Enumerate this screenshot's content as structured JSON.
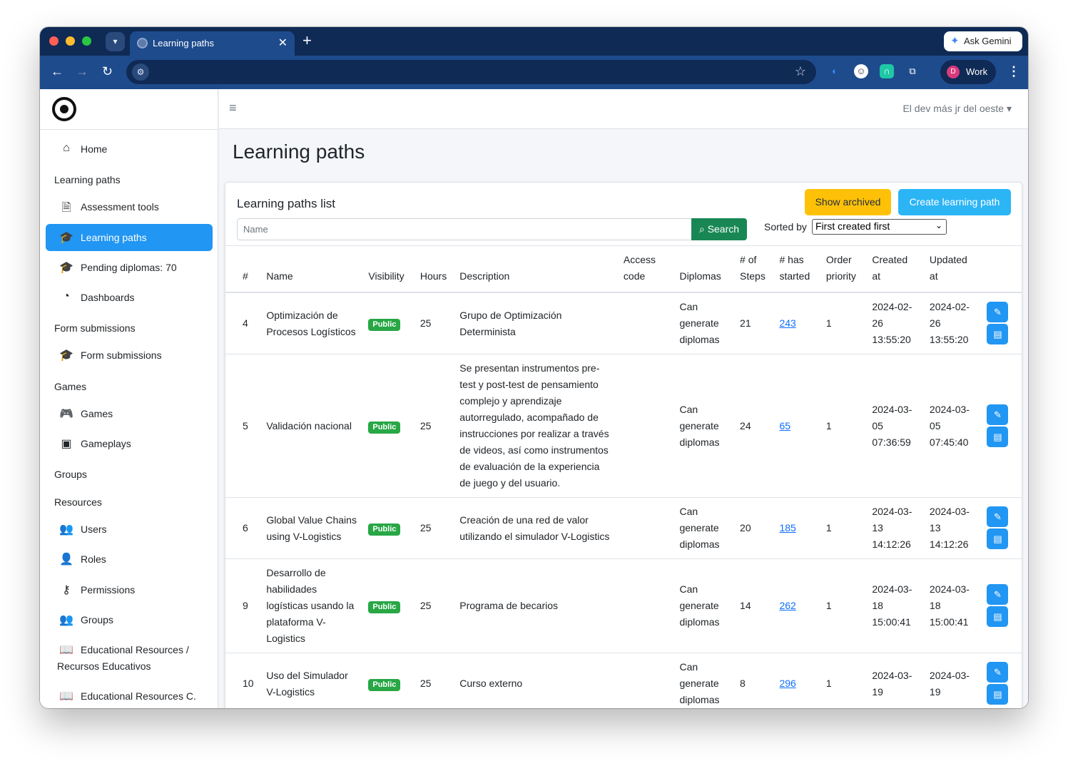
{
  "browser": {
    "tab_title": "Learning paths",
    "tab_close": "✕",
    "new_tab": "+",
    "ask_gemini": "Ask Gemini",
    "profile_initial": "D",
    "profile_name": "Work"
  },
  "sidebar": {
    "items": [
      {
        "type": "item",
        "icon": "home-icon",
        "label": "Home"
      },
      {
        "type": "header",
        "label": "Learning paths"
      },
      {
        "type": "item",
        "icon": "file-icon",
        "label": "Assessment tools"
      },
      {
        "type": "item",
        "icon": "graduation-cap-icon",
        "label": "Learning paths",
        "active": true
      },
      {
        "type": "item",
        "icon": "graduation-cap-icon",
        "label": "Pending diplomas: 70"
      },
      {
        "type": "item",
        "icon": "dashboard-icon",
        "label": "Dashboards"
      },
      {
        "type": "header",
        "label": "Form submissions"
      },
      {
        "type": "item",
        "icon": "graduation-cap-icon",
        "label": "Form submissions"
      },
      {
        "type": "header",
        "label": "Games"
      },
      {
        "type": "item",
        "icon": "gamepad-icon",
        "label": "Games"
      },
      {
        "type": "item",
        "icon": "save-icon",
        "label": "Gameplays"
      },
      {
        "type": "header",
        "label": "Groups"
      },
      {
        "type": "header",
        "label": "Resources"
      },
      {
        "type": "item",
        "icon": "users-icon",
        "label": "Users"
      },
      {
        "type": "item",
        "icon": "user-tag-icon",
        "label": "Roles"
      },
      {
        "type": "item",
        "icon": "key-icon",
        "label": "Permissions"
      },
      {
        "type": "item",
        "icon": "group-icon",
        "label": "Groups"
      },
      {
        "type": "item",
        "icon": "book-icon",
        "label": "Educational Resources / Recursos Educativos"
      },
      {
        "type": "item",
        "icon": "book-icon",
        "label": "Educational Resources C."
      }
    ]
  },
  "topnav": {
    "user": "El dev más jr del oeste"
  },
  "page": {
    "title": "Learning paths"
  },
  "card": {
    "title": "Learning paths list",
    "show_archived": "Show archived",
    "create": "Create learning path",
    "search_placeholder": "Name",
    "search_button": "Search",
    "sorted_by_label": "Sorted by",
    "sorted_by_value": "First created first"
  },
  "table": {
    "headers": [
      "#",
      "Name",
      "Visibility",
      "Hours",
      "Description",
      "Access code",
      "Diplomas",
      "# of Steps",
      "# has started",
      "Order priority",
      "Created at",
      "Updated at"
    ],
    "rows": [
      {
        "id": "4",
        "name": "Optimización de Procesos Logísticos",
        "visibility": "Public",
        "hours": "25",
        "description": "Grupo de Optimización Determinista",
        "access_code": "",
        "diplomas": "Can generate diplomas",
        "steps": "21",
        "started": "243",
        "priority": "1",
        "created": "2024-02-26 13:55:20",
        "updated": "2024-02-26 13:55:20"
      },
      {
        "id": "5",
        "name": "Validación nacional",
        "visibility": "Public",
        "hours": "25",
        "description": "Se presentan instrumentos pre-test y post-test de pensamiento complejo y aprendizaje autorregulado, acompañado de instrucciones por realizar a través de videos, así como instrumentos de evaluación de la experiencia de juego y del usuario.",
        "access_code": "",
        "diplomas": "Can generate diplomas",
        "steps": "24",
        "started": "65",
        "priority": "1",
        "created": "2024-03-05 07:36:59",
        "updated": "2024-03-05 07:45:40"
      },
      {
        "id": "6",
        "name": "Global Value Chains using V-Logistics",
        "visibility": "Public",
        "hours": "25",
        "description": "Creación de una red de valor utilizando el simulador V-Logistics",
        "access_code": "",
        "diplomas": "Can generate diplomas",
        "steps": "20",
        "started": "185",
        "priority": "1",
        "created": "2024-03-13 14:12:26",
        "updated": "2024-03-13 14:12:26"
      },
      {
        "id": "9",
        "name": "Desarrollo de habilidades logísticas usando la plataforma V-Logistics",
        "visibility": "Public",
        "hours": "25",
        "description": "Programa de becarios",
        "access_code": "",
        "diplomas": "Can generate diplomas",
        "steps": "14",
        "started": "262",
        "priority": "1",
        "created": "2024-03-18 15:00:41",
        "updated": "2024-03-18 15:00:41"
      },
      {
        "id": "10",
        "name": "Uso del Simulador V-Logistics",
        "visibility": "Public",
        "hours": "25",
        "description": "Curso externo",
        "access_code": "",
        "diplomas": "Can generate diplomas",
        "steps": "8",
        "started": "296",
        "priority": "1",
        "created": "2024-03-19",
        "updated": "2024-03-19"
      }
    ]
  }
}
